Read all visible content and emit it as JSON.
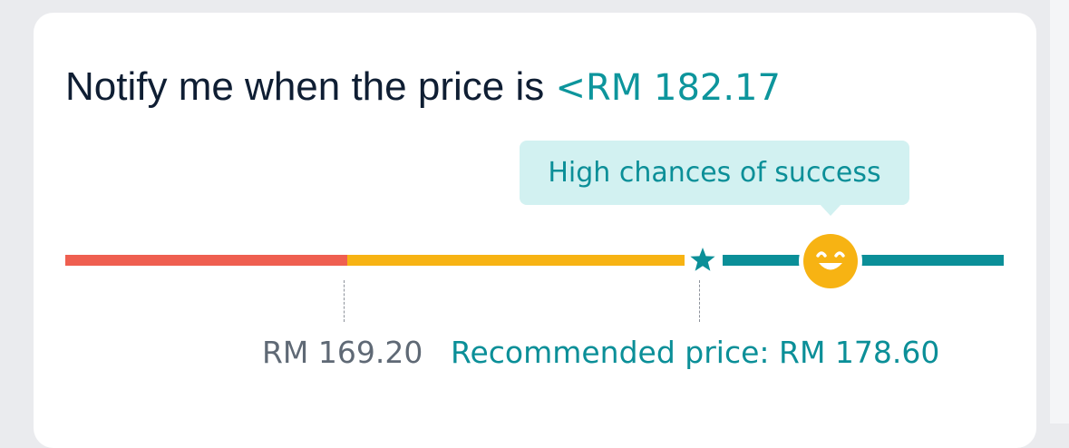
{
  "alert": {
    "prefix": "Notify me when the price is ",
    "target_price": "<RM 182.17"
  },
  "tooltip": {
    "text": "High chances of success"
  },
  "scale": {
    "lower_label": "RM 169.20",
    "recommended_label": "Recommended price: RM 178.60",
    "marker_icon": "star-icon",
    "knob_icon": "smiley-face-icon"
  },
  "colors": {
    "low": "#ef5f50",
    "medium": "#f7b313",
    "high": "#0b8f98",
    "knob": "#f7b313"
  }
}
